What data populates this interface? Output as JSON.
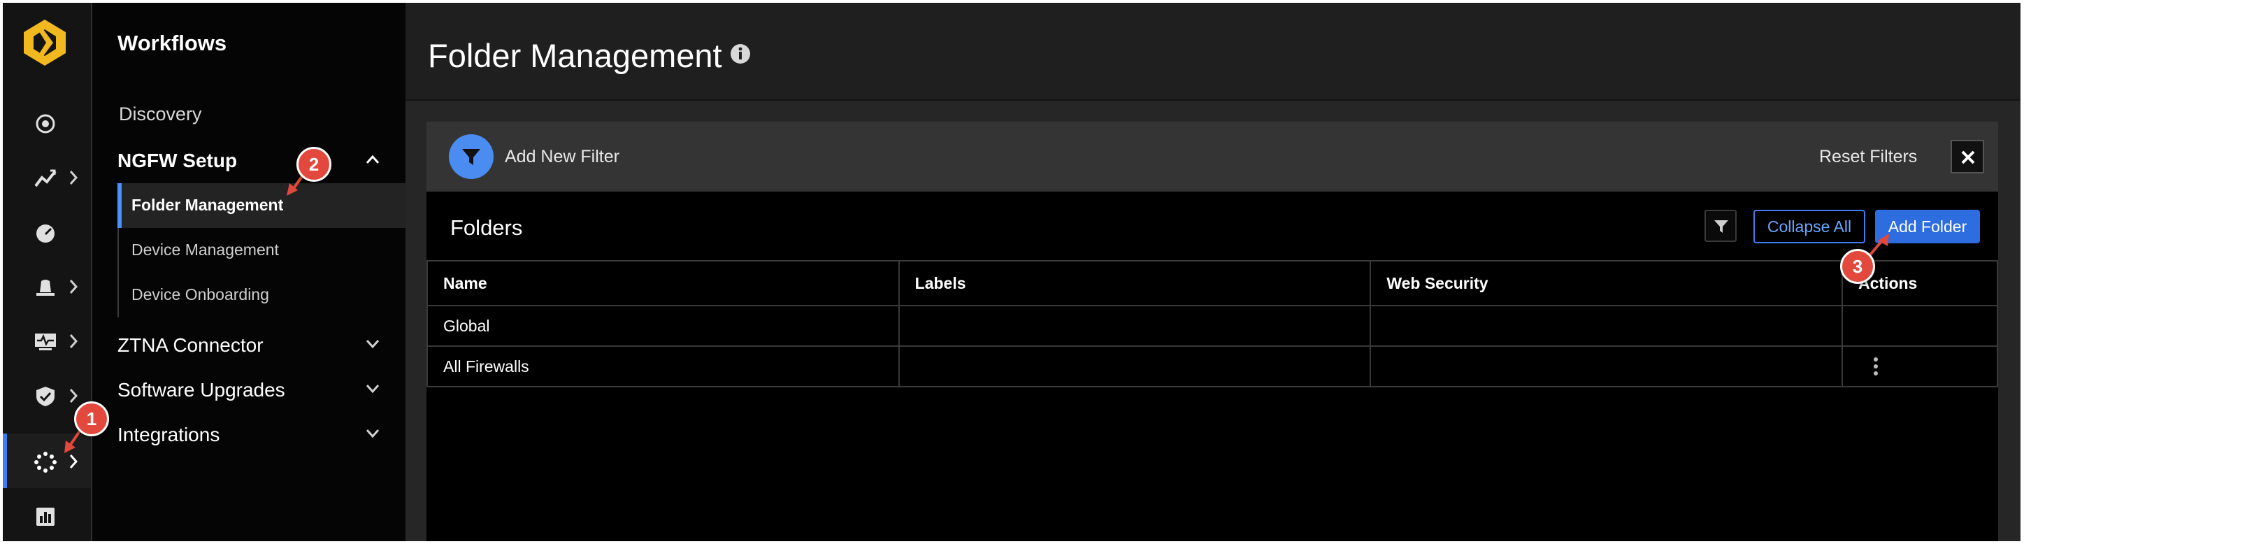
{
  "rail": {
    "items": [
      {
        "icon": "target-icon",
        "has_chevron": false
      },
      {
        "icon": "analytics-icon",
        "has_chevron": true
      },
      {
        "icon": "gauge-icon",
        "has_chevron": false
      },
      {
        "icon": "alarm-bell-icon",
        "has_chevron": true
      },
      {
        "icon": "monitor-icon",
        "has_chevron": true
      },
      {
        "icon": "shield-check-icon",
        "has_chevron": true
      },
      {
        "icon": "workflows-icon",
        "has_chevron": true,
        "active": true
      },
      {
        "icon": "reports-icon",
        "has_chevron": false
      }
    ]
  },
  "workflows": {
    "title": "Workflows",
    "discovery": "Discovery",
    "ngfw_setup": {
      "label": "NGFW Setup",
      "items": [
        "Folder Management",
        "Device Management",
        "Device Onboarding"
      ]
    },
    "ztna": "ZTNA Connector",
    "software": "Software Upgrades",
    "integrations": "Integrations"
  },
  "page": {
    "title": "Folder Management"
  },
  "filter_bar": {
    "add_filter": "Add New Filter",
    "reset": "Reset Filters"
  },
  "folders": {
    "title": "Folders",
    "collapse_all": "Collapse All",
    "add_folder": "Add Folder",
    "columns": [
      "Name",
      "Labels",
      "Web Security",
      "Actions"
    ],
    "rows": [
      {
        "name": "Global",
        "labels": "",
        "web_security": ""
      },
      {
        "name": "All Firewalls",
        "labels": "",
        "web_security": ""
      }
    ]
  },
  "annotations": [
    "1",
    "2",
    "3"
  ],
  "colors": {
    "accent": "#3d7df0",
    "primary_button": "#2d6de0",
    "logo": "#f2b81f",
    "marker": "#e2483b"
  }
}
